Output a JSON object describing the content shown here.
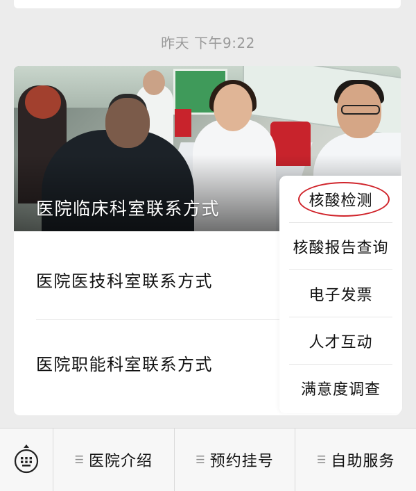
{
  "chat": {
    "timestamp": "昨天 下午9:22"
  },
  "article": {
    "cover_title": "医院临床科室联系方式",
    "items": [
      {
        "label": "医院医技科室联系方式"
      },
      {
        "label": "医院职能科室联系方式"
      }
    ]
  },
  "popup_menu": {
    "items": [
      {
        "label": "核酸检测",
        "highlighted": true
      },
      {
        "label": "核酸报告查询"
      },
      {
        "label": "电子发票"
      },
      {
        "label": "人才互动"
      },
      {
        "label": "满意度调查"
      }
    ]
  },
  "bottom_menu": {
    "keyboard_icon": "keyboard-icon",
    "menu_icon": "hamburger-icon",
    "tabs": [
      {
        "label": "医院介绍"
      },
      {
        "label": "预约挂号"
      },
      {
        "label": "自助服务"
      }
    ]
  },
  "colors": {
    "background": "#ececec",
    "highlight_ring": "#d0242b",
    "timestamp_text": "#9a9a9a"
  }
}
